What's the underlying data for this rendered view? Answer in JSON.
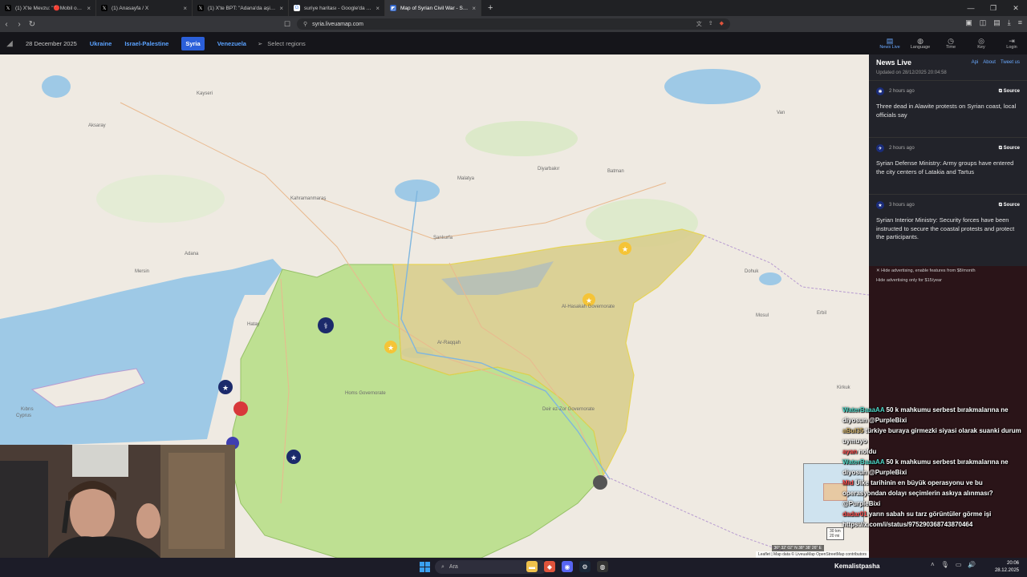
{
  "tabs": [
    {
      "label": "(1) X'te Mevzu: \"🔴Mobil oyunda Ro",
      "icon": "x-logo-icon"
    },
    {
      "label": "(1) Anasayfa / X",
      "icon": "x-logo-icon"
    },
    {
      "label": "(1) X'te BPT: \"Adana'da aşiret menso",
      "icon": "x-logo-icon"
    },
    {
      "label": "suriye haritası - Google'da Ara",
      "icon": "google-icon"
    },
    {
      "label": "Map of Syrian Civil War - Syria ne",
      "icon": "liveuamap-icon",
      "active": true
    }
  ],
  "address": {
    "url": "syria.liveuamap.com"
  },
  "header": {
    "date": "28 December 2025",
    "regions": [
      "Ukraine",
      "Israel-Palestine",
      "Syria",
      "Venezuela"
    ],
    "active_region": "Syria",
    "select_regions": "Select regions",
    "icons": [
      {
        "label": "News Live",
        "icon": "news-icon"
      },
      {
        "label": "Language",
        "icon": "globe-icon"
      },
      {
        "label": "Time",
        "icon": "clock-icon"
      },
      {
        "label": "Key",
        "icon": "key-icon"
      },
      {
        "label": "Login",
        "icon": "login-icon"
      }
    ]
  },
  "map": {
    "labels": [
      {
        "t": "Aksaray"
      },
      {
        "t": "Kayseri"
      },
      {
        "t": "Malatya"
      },
      {
        "t": "Diyarbakır"
      },
      {
        "t": "Batman"
      },
      {
        "t": "Van"
      },
      {
        "t": "Kahramanmaraş"
      },
      {
        "t": "Adana"
      },
      {
        "t": "Mersin"
      },
      {
        "t": "Şanlıurfa"
      },
      {
        "t": "Hatay"
      },
      {
        "t": "Dohuk"
      },
      {
        "t": "Mosul"
      },
      {
        "t": "Erbil"
      },
      {
        "t": "Kirkuk"
      },
      {
        "t": "Cyprus"
      },
      {
        "t": "Kıbrıs"
      },
      {
        "t": "Al-Hasakah Governorate"
      },
      {
        "t": "Deir ez-Zor Governorate"
      },
      {
        "t": "Ar-Raqqah"
      },
      {
        "t": "Homs Governorate"
      }
    ],
    "scale_text": [
      "30 km",
      "20 mi"
    ],
    "coords": "36° 32' 02\" N 38° 38' 26\" E",
    "attribution": "Leaflet | Map data © LiveuaMap OpenStreetMap contributors"
  },
  "sidebar": {
    "title": "News Live",
    "links": [
      "Api",
      "About",
      "Tweet us"
    ],
    "updated": "Updated on 28/12/2025 20:04:58",
    "news": [
      {
        "time": "2 hours ago",
        "source": "Source",
        "text": "Three dead in Alawite protests on Syrian coast, local officials say"
      },
      {
        "time": "2 hours ago",
        "source": "Source",
        "text": "Syrian Defense Ministry: Army groups have entered the city centers of Latakia and Tartus"
      },
      {
        "time": "3 hours ago",
        "source": "Source",
        "text": "Syrian Interior Ministry: Security forces have been instructed to secure the coastal protests and protect the participants."
      }
    ],
    "ad_lines": [
      "Hide advertising, enable features from $8/month",
      "Hide advertising only for $15/year"
    ]
  },
  "chat": [
    {
      "user": "WaterBaaaAA",
      "text": "50 k mahkumu serbest bırakmalarına ne diyosun @PurpleBixi"
    },
    {
      "user": "aBuI35",
      "text": "türkiye buraya girmezki siyasi olarak suanki durum uymuyo"
    },
    {
      "user": "ayan",
      "text": "noldu"
    },
    {
      "user": "WaterBaaaAA",
      "text": "50 k mahkumu serbest bırakmalarına ne diyosun @PurpleBixi"
    },
    {
      "user": "Mid",
      "text": "Ülke tarihinin en büyük operasyonu ve bu operasyondan dolayı seçimlerin askıya alınması?"
    },
    {
      "user": "",
      "text": "@PurpleBixi"
    },
    {
      "user": "dadar01",
      "text": "yarın sabah su tarz görüntüler görme işi"
    },
    {
      "user": "",
      "text": "https://x.com/i/status/975290368743870464"
    }
  ],
  "taskbar": {
    "search": "Ara",
    "user": "Kemalistpasha",
    "time": "20:06",
    "date": "28.12.2025"
  },
  "colors": {
    "gov": "#b9df8a",
    "sdf": "#d9cf8e",
    "water": "#9ec9e6",
    "accent": "#2b5fd9"
  }
}
